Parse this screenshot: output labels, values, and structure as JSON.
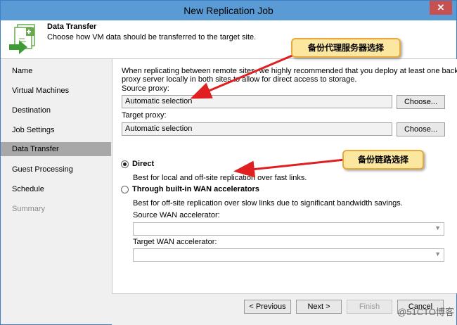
{
  "window": {
    "title": "New Replication Job",
    "close_glyph": "✕"
  },
  "header": {
    "title": "Data Transfer",
    "subtitle": "Choose how VM data should be transferred to the target site.",
    "icon": "data-transfer-icon"
  },
  "sidebar": {
    "items": [
      {
        "label": "Name",
        "state": "normal"
      },
      {
        "label": "Virtual Machines",
        "state": "normal"
      },
      {
        "label": "Destination",
        "state": "normal"
      },
      {
        "label": "Job Settings",
        "state": "normal"
      },
      {
        "label": "Data Transfer",
        "state": "active"
      },
      {
        "label": "Guest Processing",
        "state": "normal"
      },
      {
        "label": "Schedule",
        "state": "normal"
      },
      {
        "label": "Summary",
        "state": "disabled"
      }
    ]
  },
  "main": {
    "intro_line1": "When replicating between remote sites, we highly recommended that you deploy at least one backup",
    "intro_line2": "proxy server locally in both sites to allow for direct access to storage.",
    "source_proxy_label": "Source proxy:",
    "source_proxy_value": "Automatic selection",
    "target_proxy_label": "Target proxy:",
    "target_proxy_value": "Automatic selection",
    "choose_label": "Choose...",
    "direct_label": "Direct",
    "direct_desc": "Best for local and off-site replication over fast links.",
    "wan_label": "Through built-in WAN accelerators",
    "wan_desc": "Best for off-site replication over slow links due to significant bandwidth savings.",
    "source_wan_label": "Source WAN accelerator:",
    "target_wan_label": "Target WAN accelerator:",
    "source_wan_value": "",
    "target_wan_value": "",
    "selected_option": "Direct"
  },
  "footer": {
    "previous": "< Previous",
    "next": "Next >",
    "finish": "Finish",
    "cancel": "Cancel"
  },
  "annotations": {
    "proxy_callout": "备份代理服务器选择",
    "link_callout": "备份链路选择",
    "arrow_color": "#e02020"
  },
  "watermark": "@51CTO博客"
}
